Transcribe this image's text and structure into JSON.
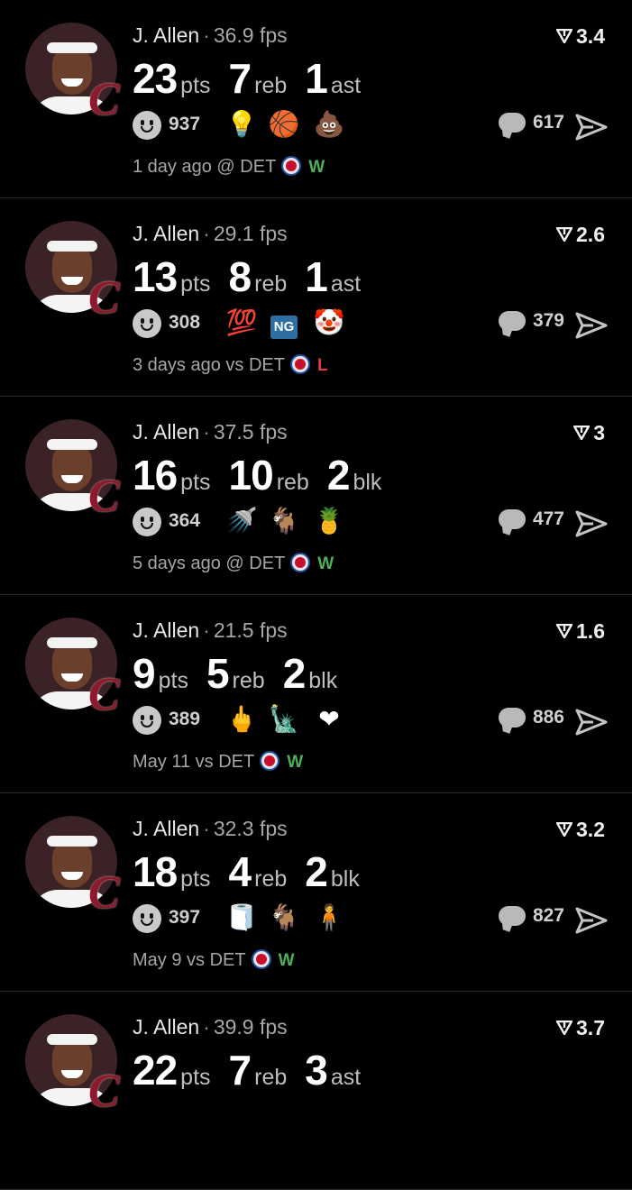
{
  "colors": {
    "background": "#000000",
    "win": "#4db05a",
    "loss": "#e23b3b",
    "divider": "#2a2a2a"
  },
  "icons": {
    "score": "filter-triangle-icon",
    "reaction": "smiley-face-icon",
    "comment": "speech-bubble-icon",
    "share": "paper-plane-icon",
    "opponent": "detroit-pistons-logo",
    "team": "cleveland-cavaliers-logo"
  },
  "cards": [
    {
      "player": "J. Allen",
      "fps": "36.9 fps",
      "score": "3.4",
      "stats": [
        {
          "num": "23",
          "lbl": "pts"
        },
        {
          "num": "7",
          "lbl": "reb"
        },
        {
          "num": "1",
          "lbl": "ast"
        }
      ],
      "reactions": "937",
      "emojis": [
        "💡",
        "🏀",
        "💩"
      ],
      "comments": "617",
      "when": "1 day ago",
      "venue": "@ DET",
      "result": "W",
      "result_type": "win"
    },
    {
      "player": "J. Allen",
      "fps": "29.1 fps",
      "score": "2.6",
      "stats": [
        {
          "num": "13",
          "lbl": "pts"
        },
        {
          "num": "8",
          "lbl": "reb"
        },
        {
          "num": "1",
          "lbl": "ast"
        }
      ],
      "reactions": "308",
      "emojis": [
        "💯",
        "NG",
        "🤡"
      ],
      "comments": "379",
      "when": "3 days ago",
      "venue": "vs DET",
      "result": "L",
      "result_type": "loss"
    },
    {
      "player": "J. Allen",
      "fps": "37.5 fps",
      "score": "3",
      "stats": [
        {
          "num": "16",
          "lbl": "pts"
        },
        {
          "num": "10",
          "lbl": "reb"
        },
        {
          "num": "2",
          "lbl": "blk"
        }
      ],
      "reactions": "364",
      "emojis": [
        "🚿",
        "🐐",
        "🍍"
      ],
      "comments": "477",
      "when": "5 days ago",
      "venue": "@ DET",
      "result": "W",
      "result_type": "win"
    },
    {
      "player": "J. Allen",
      "fps": "21.5 fps",
      "score": "1.6",
      "stats": [
        {
          "num": "9",
          "lbl": "pts"
        },
        {
          "num": "5",
          "lbl": "reb"
        },
        {
          "num": "2",
          "lbl": "blk"
        }
      ],
      "reactions": "389",
      "emojis": [
        "🖕",
        "🗽",
        "❤"
      ],
      "comments": "886",
      "when": "May 11",
      "venue": "vs DET",
      "result": "W",
      "result_type": "win"
    },
    {
      "player": "J. Allen",
      "fps": "32.3 fps",
      "score": "3.2",
      "stats": [
        {
          "num": "18",
          "lbl": "pts"
        },
        {
          "num": "4",
          "lbl": "reb"
        },
        {
          "num": "2",
          "lbl": "blk"
        }
      ],
      "reactions": "397",
      "emojis": [
        "🧻",
        "🐐",
        "🧍"
      ],
      "comments": "827",
      "when": "May 9",
      "venue": "vs DET",
      "result": "W",
      "result_type": "win"
    },
    {
      "player": "J. Allen",
      "fps": "39.9 fps",
      "score": "3.7",
      "stats": [
        {
          "num": "22",
          "lbl": "pts"
        },
        {
          "num": "7",
          "lbl": "reb"
        },
        {
          "num": "3",
          "lbl": "ast"
        }
      ],
      "reactions": "",
      "emojis": [],
      "comments": "",
      "when": "",
      "venue": "",
      "result": "",
      "result_type": "win"
    }
  ]
}
